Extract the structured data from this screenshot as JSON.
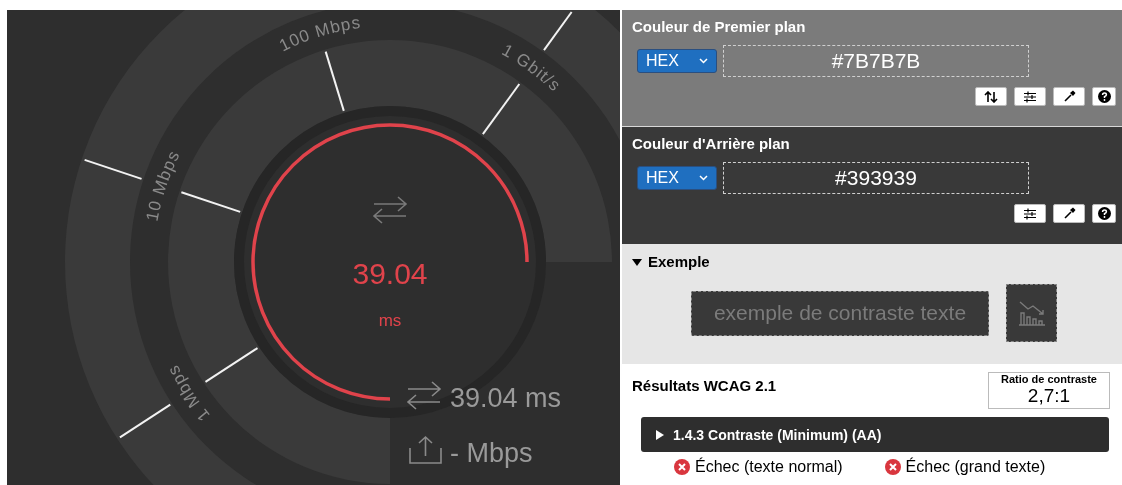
{
  "gauge": {
    "scale": [
      {
        "label": "1 Mbps"
      },
      {
        "label": "10 Mbps"
      },
      {
        "label": "100 Mbps"
      },
      {
        "label": "1 Gbit/s"
      }
    ],
    "value": "39.04",
    "unit": "ms",
    "readings": [
      {
        "kind": "ping",
        "text": "39.04 ms"
      },
      {
        "kind": "upload",
        "text": "- Mbps"
      }
    ]
  },
  "foreground": {
    "title": "Couleur de Premier plan",
    "format": "HEX",
    "value": "#7B7B7B",
    "tools": [
      {
        "kind": "swap"
      },
      {
        "kind": "sliders"
      },
      {
        "kind": "eyedropper"
      },
      {
        "kind": "help"
      }
    ]
  },
  "background": {
    "title": "Couleur d'Arrière plan",
    "format": "HEX",
    "value": "#393939",
    "tools": [
      {
        "kind": "sliders"
      },
      {
        "kind": "eyedropper"
      },
      {
        "kind": "help"
      }
    ]
  },
  "example": {
    "title": "Exemple",
    "expanded": true,
    "sample": "exemple de contraste texte"
  },
  "results": {
    "title": "Résultats WCAG 2.1",
    "ratio_label": "Ratio de contraste",
    "ratio": "2,7:1",
    "criterion": {
      "label": "1.4.3 Contraste (Minimum) (AA)",
      "expanded": false
    },
    "outcomes": [
      {
        "text": "Échec (texte normal)",
        "passed": false
      },
      {
        "text": "Échec (grand texte)",
        "passed": false
      }
    ]
  }
}
